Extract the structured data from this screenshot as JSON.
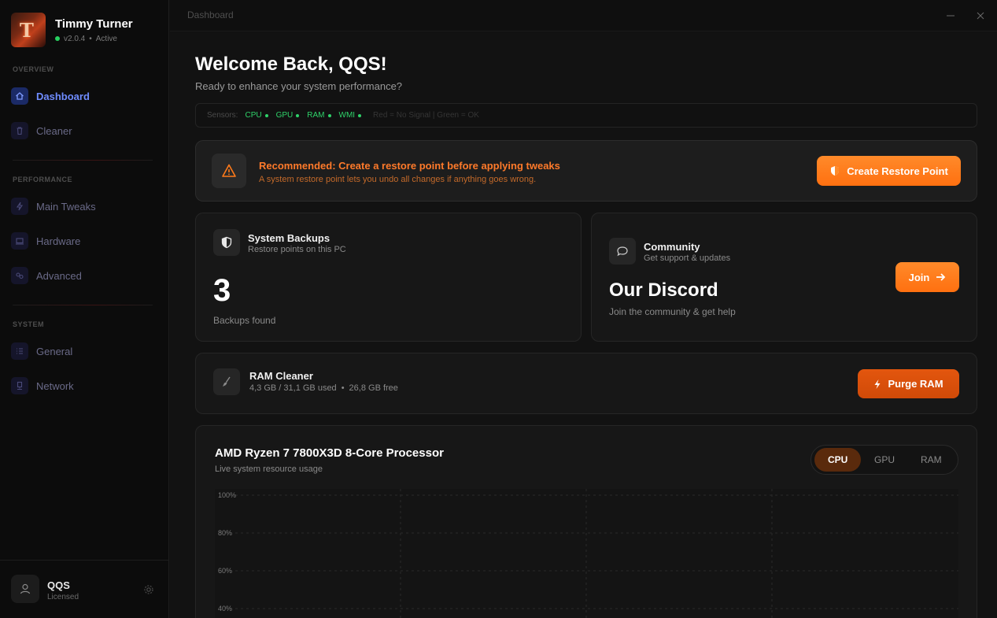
{
  "sidebar": {
    "app_title": "Timmy Turner",
    "version": "v2.0.4",
    "status": "Active",
    "sections": {
      "overview": "OVERVIEW",
      "performance": "PERFORMANCE",
      "system": "SYSTEM"
    },
    "items": {
      "dashboard": "Dashboard",
      "cleaner": "Cleaner",
      "main_tweaks": "Main Tweaks",
      "hardware": "Hardware",
      "advanced": "Advanced",
      "general": "General",
      "network": "Network"
    },
    "user": {
      "name": "QQS",
      "status": "Licensed"
    }
  },
  "topbar": {
    "breadcrumb": "Dashboard"
  },
  "main": {
    "welcome_title": "Welcome Back, QQS!",
    "welcome_sub": "Ready to enhance your system performance?",
    "sensors": {
      "label": "Sensors:",
      "items": [
        "CPU",
        "GPU",
        "RAM",
        "WMI"
      ],
      "legend": "Red = No Signal  |  Green = OK"
    },
    "alert": {
      "title": "Recommended: Create a restore point before applying tweaks",
      "text": "A system restore point lets you undo all changes if anything goes wrong.",
      "button": "Create Restore Point"
    },
    "backups": {
      "title": "System Backups",
      "sub": "Restore points on this PC",
      "count": "3",
      "caption": "Backups found"
    },
    "community": {
      "title": "Community",
      "sub": "Get support & updates",
      "heading": "Our Discord",
      "text": "Join the community & get help",
      "button": "Join"
    },
    "ram_cleaner": {
      "title": "RAM Cleaner",
      "used": "4,3 GB / 31,1 GB used",
      "free": "26,8 GB free",
      "button": "Purge RAM"
    },
    "cpu": {
      "title": "AMD Ryzen 7 7800X3D 8-Core Processor",
      "sub": "Live system resource usage",
      "tabs": [
        "CPU",
        "GPU",
        "RAM"
      ],
      "active_tab": "CPU"
    }
  },
  "colors": {
    "accent_blue": "#6f8cff",
    "accent_orange": "#ff7a1a",
    "ok_green": "#2fd36a",
    "background": "#121212"
  },
  "chart_data": {
    "type": "line",
    "title": "",
    "y_tick_labels": [
      "100%",
      "80%",
      "60%",
      "40%"
    ],
    "ylim": [
      0,
      100
    ],
    "grid": true,
    "series": []
  }
}
